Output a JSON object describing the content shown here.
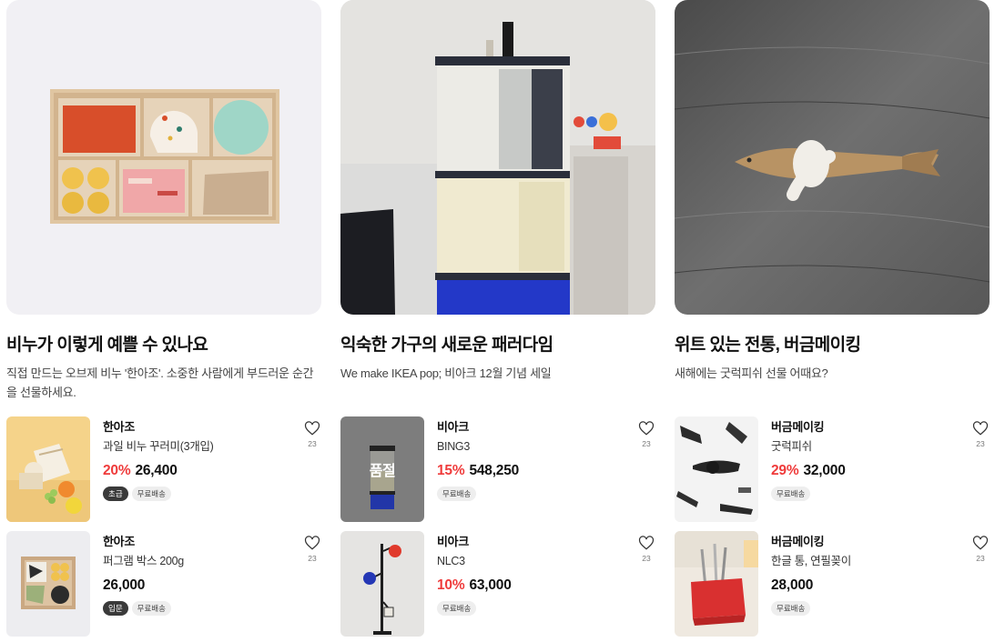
{
  "features": [
    {
      "title": "비누가 이렇게 예쁠 수 있나요",
      "description": "직접 만드는 오브제 비누 '한아조'. 소중한 사람에게 부드러운 순간을 선물하세요.",
      "image": "soap-box-photo",
      "products": [
        {
          "image": "wrapped-soap-fruit-photo",
          "brand": "한아조",
          "name": "과일 비누 꾸러미(3개입)",
          "discount": "20%",
          "price": "26,400",
          "sold_out": "",
          "badge_dark": "초급",
          "badge_light": "무료배송",
          "likes": "23"
        },
        {
          "image": "puzzle-soap-box-photo",
          "brand": "한아조",
          "name": "퍼그램 박스 200g",
          "discount": "",
          "price": "26,000",
          "sold_out": "",
          "badge_dark": "입문",
          "badge_light": "무료배송",
          "likes": "23"
        }
      ]
    },
    {
      "title": "익숙한 가구의 새로운 패러다임",
      "description": "We make IKEA pop; 비아크 12월 기념 세일",
      "image": "shelf-tower-photo",
      "products": [
        {
          "image": "bing3-shelf-photo",
          "brand": "비아크",
          "name": "BING3",
          "discount": "15%",
          "price": "548,250",
          "sold_out": "품절",
          "badge_dark": "",
          "badge_light": "무료배송",
          "likes": "23"
        },
        {
          "image": "nlc3-lamp-photo",
          "brand": "비아크",
          "name": "NLC3",
          "discount": "10%",
          "price": "63,000",
          "sold_out": "",
          "badge_dark": "",
          "badge_light": "무료배송",
          "likes": "23"
        }
      ]
    },
    {
      "title": "위트 있는 전통, 버금메이킹",
      "description": "새해에는 굿럭피쉬 선물 어때요?",
      "image": "knotted-fish-photo",
      "products": [
        {
          "image": "goodluck-fish-photo",
          "brand": "버금메이킹",
          "name": "굿럭피쉬",
          "discount": "29%",
          "price": "32,000",
          "sold_out": "",
          "badge_dark": "",
          "badge_light": "무료배송",
          "likes": "23"
        },
        {
          "image": "utensil-holder-photo",
          "brand": "버금메이킹",
          "name": "한글 통, 연필꽂이",
          "discount": "",
          "price": "28,000",
          "sold_out": "",
          "badge_dark": "",
          "badge_light": "무료배송",
          "likes": "23"
        }
      ]
    }
  ],
  "icons": {
    "like": "heart-icon"
  },
  "colors": {
    "discount": "#ef3b3b",
    "badge_dark": "#3a3a3a",
    "badge_light": "#eeeeee"
  }
}
